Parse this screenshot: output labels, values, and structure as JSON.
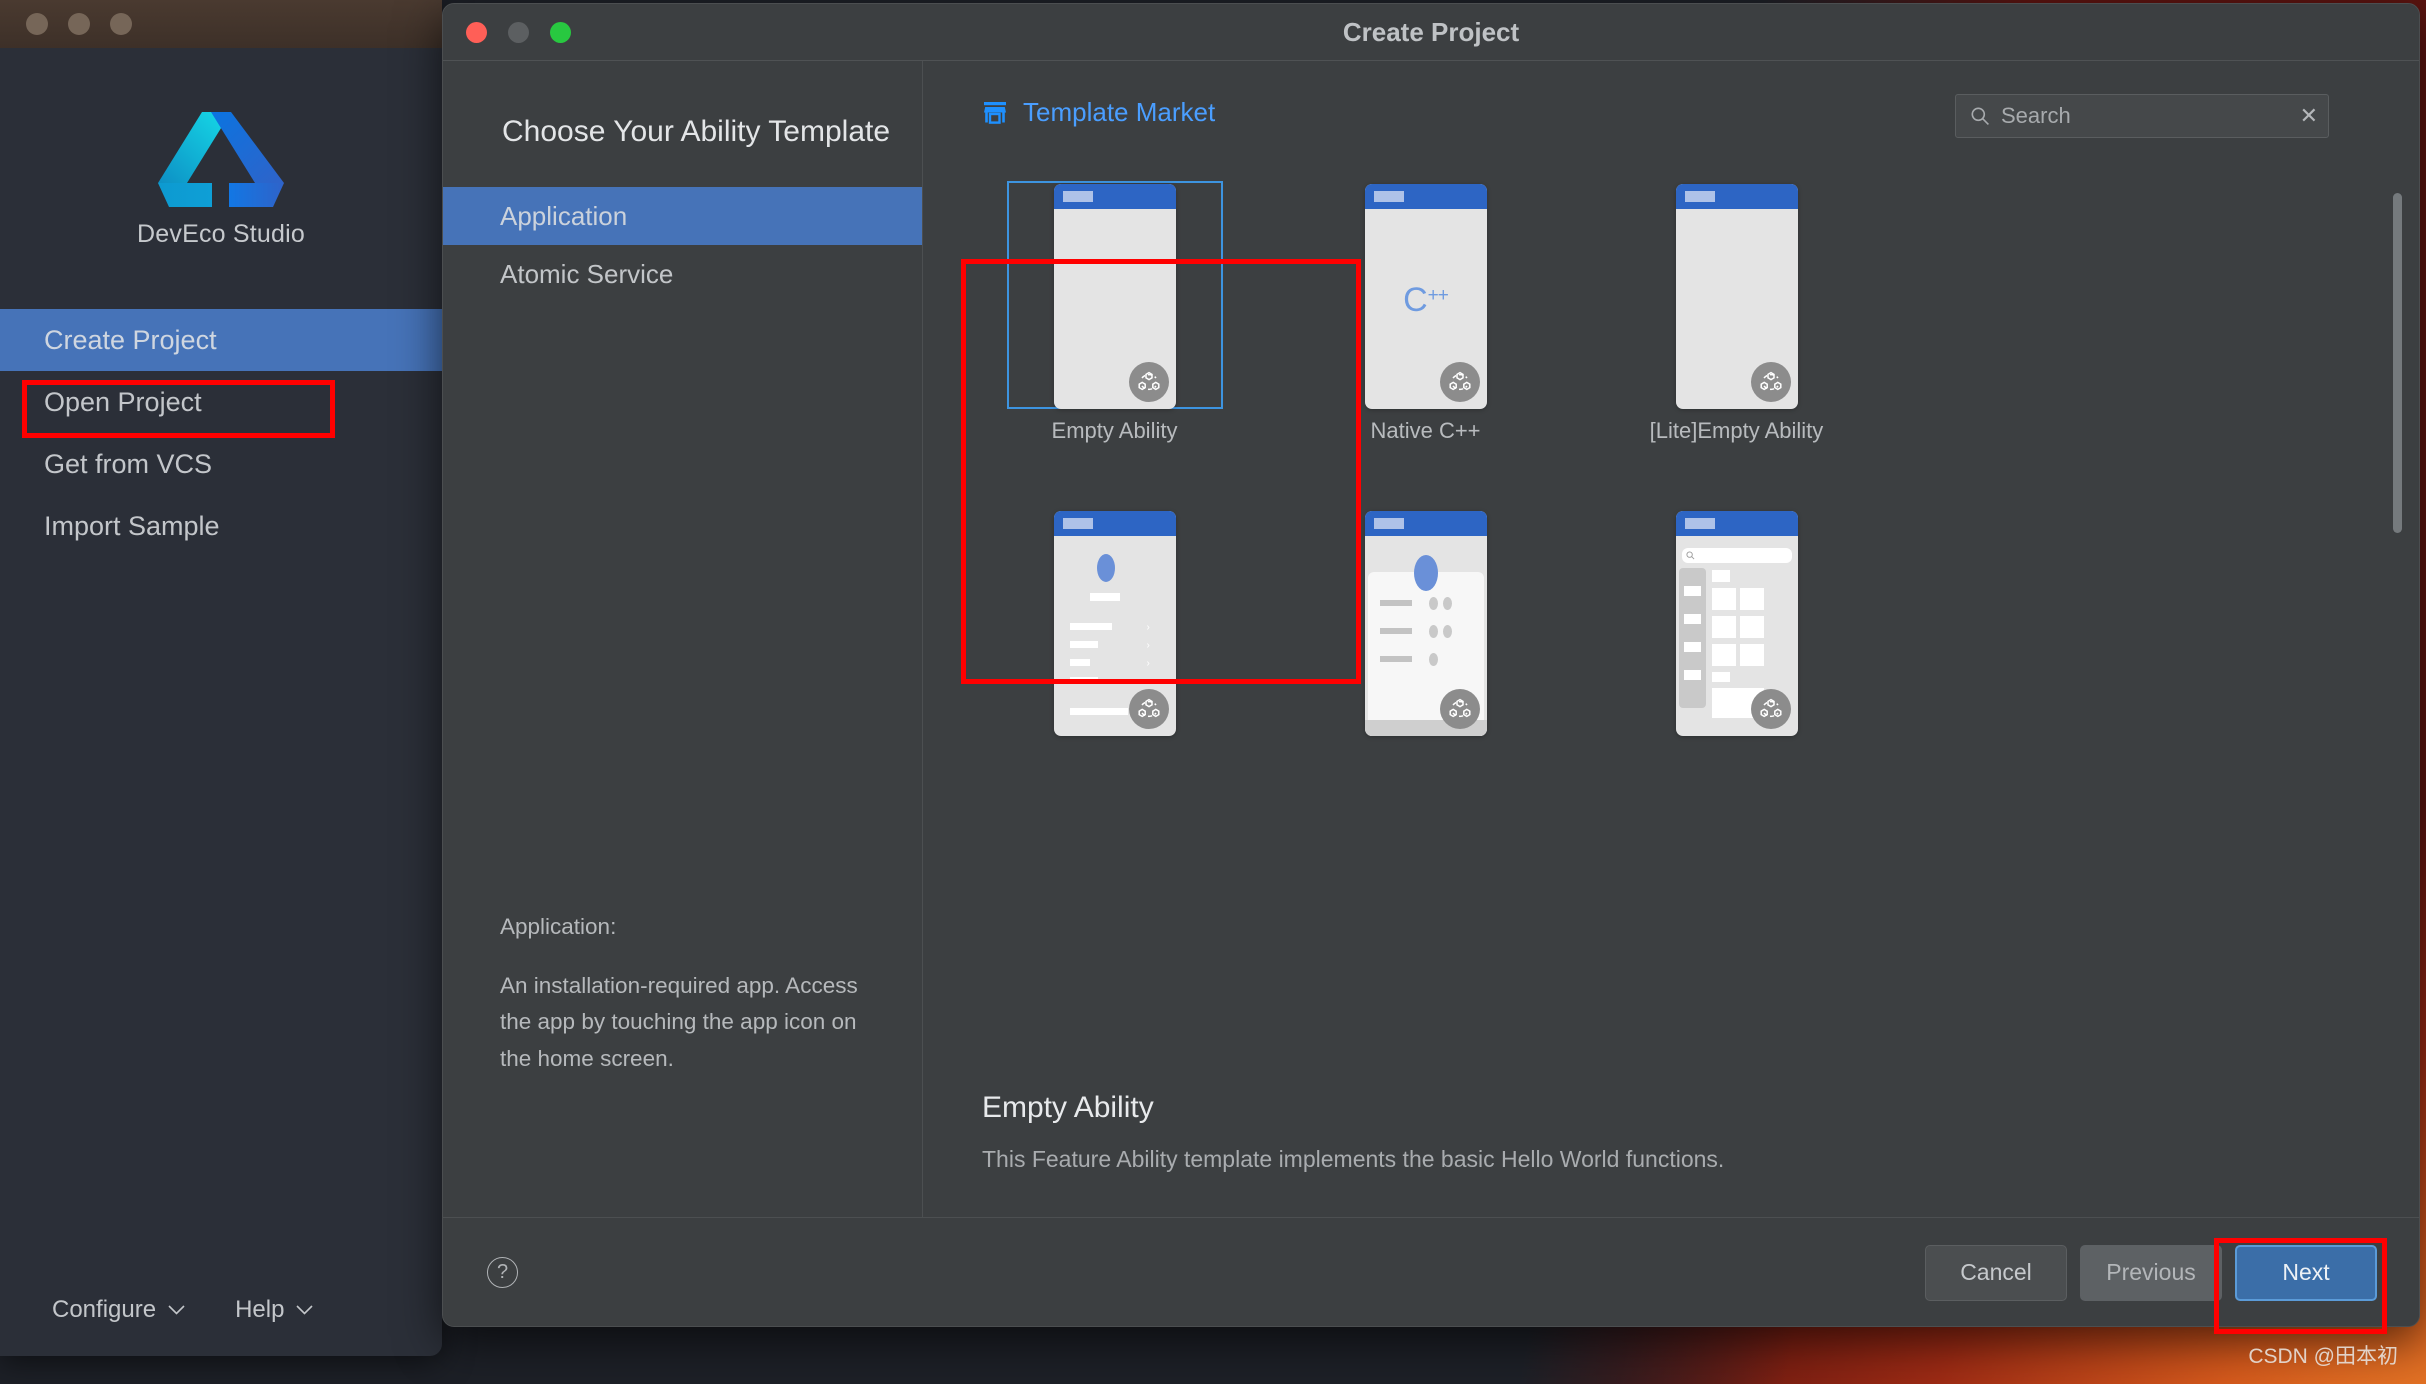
{
  "welcome": {
    "app_title": "DevEco Studio",
    "menu": [
      {
        "label": "Create Project",
        "active": true
      },
      {
        "label": "Open Project",
        "active": false
      },
      {
        "label": "Get from VCS",
        "active": false
      },
      {
        "label": "Import Sample",
        "active": false
      }
    ],
    "footer": {
      "configure_label": "Configure",
      "help_label": "Help"
    }
  },
  "dialog": {
    "title": "Create Project",
    "heading": "Choose Your Ability Template",
    "project_types": [
      {
        "label": "Application",
        "selected": true
      },
      {
        "label": "Atomic Service",
        "selected": false
      }
    ],
    "type_description": {
      "label": "Application:",
      "text": "An installation-required app. Access the app by touching the app icon on the home screen."
    },
    "template_market_label": "Template Market",
    "search": {
      "placeholder": "Search",
      "value": "",
      "clear_label": "✕"
    },
    "templates": [
      {
        "label": "Empty Ability",
        "kind": "plain",
        "selected": true
      },
      {
        "label": "Native C++",
        "kind": "cpp",
        "selected": false,
        "glyph": "C",
        "glyph_sup": "++"
      },
      {
        "label": "[Lite]Empty Ability",
        "kind": "plain",
        "selected": false
      },
      {
        "label": "",
        "kind": "list",
        "selected": false
      },
      {
        "label": "",
        "kind": "profile",
        "selected": false
      },
      {
        "label": "",
        "kind": "catalog",
        "selected": false
      }
    ],
    "selected_template": {
      "title": "Empty Ability",
      "description": "This Feature Ability template implements the basic Hello World functions."
    },
    "footer": {
      "help_glyph": "?",
      "cancel_label": "Cancel",
      "previous_label": "Previous",
      "next_label": "Next"
    }
  },
  "watermark": "CSDN @田本初",
  "colors": {
    "accent_blue": "#4673b8",
    "link_blue": "#4a9eff",
    "primary_button": "#3b6ea8",
    "annotation_red": "#ff0000",
    "dialog_bg": "#3c3f41",
    "welcome_bg": "#2b2f38"
  }
}
